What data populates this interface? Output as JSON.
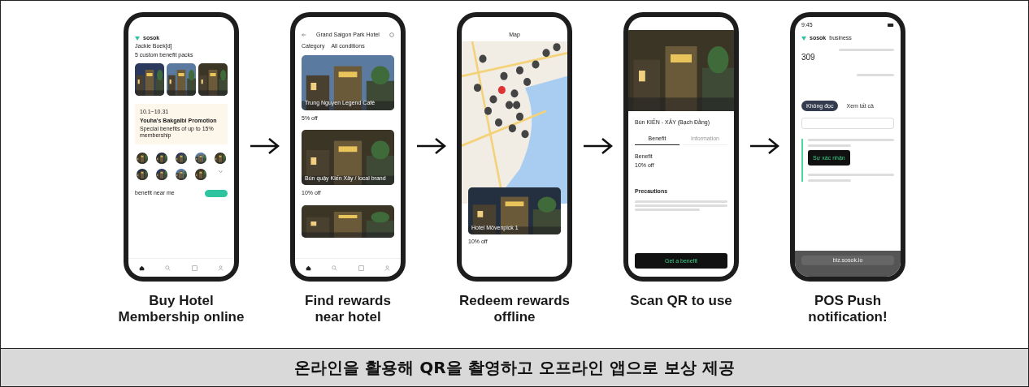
{
  "steps": [
    {
      "kind": "home",
      "label": "Buy Hotel\nMembership online",
      "brand": "sosok",
      "user": "Jackie Boek[d]",
      "subtitle": "5 custom benefit packs",
      "promo": {
        "date": "10.1~10.31",
        "title": "Youha's Bakgalbi Promotion",
        "text": "Special benefits of up to 15% membership"
      },
      "section": "benefit near me"
    },
    {
      "kind": "list",
      "label": "Find rewards\nnear hotel",
      "title": "Grand Saigon Park Hotel",
      "filters": [
        "Category",
        "All conditions"
      ],
      "cards": [
        {
          "name": "Trung Nguyen Legend Café",
          "discount": "5% off"
        },
        {
          "name": "Bún quậy Kiến Xây / local brand",
          "discount": "10% off"
        }
      ]
    },
    {
      "kind": "map",
      "label": "Redeem rewards\noffline",
      "title": "Map",
      "card": {
        "name": "Hotel Mövenpick 1",
        "discount": "10% off"
      }
    },
    {
      "kind": "detail",
      "label": "Scan QR to use",
      "name": "Bún KIẾN - XÂY (Bạch Đằng)",
      "tabs": [
        {
          "label": "Benefit",
          "selected": true
        },
        {
          "label": "Information",
          "selected": false
        }
      ],
      "benefit": "Benefit",
      "discount": "10% off",
      "section": "Precautions",
      "button": "Get a benefit"
    },
    {
      "kind": "business",
      "label": "POS Push\nnotification!",
      "time": "9:45",
      "brand": "sosok",
      "brand_suffix": "business",
      "count": "309",
      "tabs": [
        {
          "label": "Không đọc",
          "selected": true
        },
        {
          "label": "Xem tất cả",
          "selected": false
        }
      ],
      "button": "Sự xác nhận",
      "url": "biz.sosok.io"
    }
  ],
  "caption": "온라인을 활용해 QR을 촬영하고 오프라인 앱으로 보상 제공"
}
